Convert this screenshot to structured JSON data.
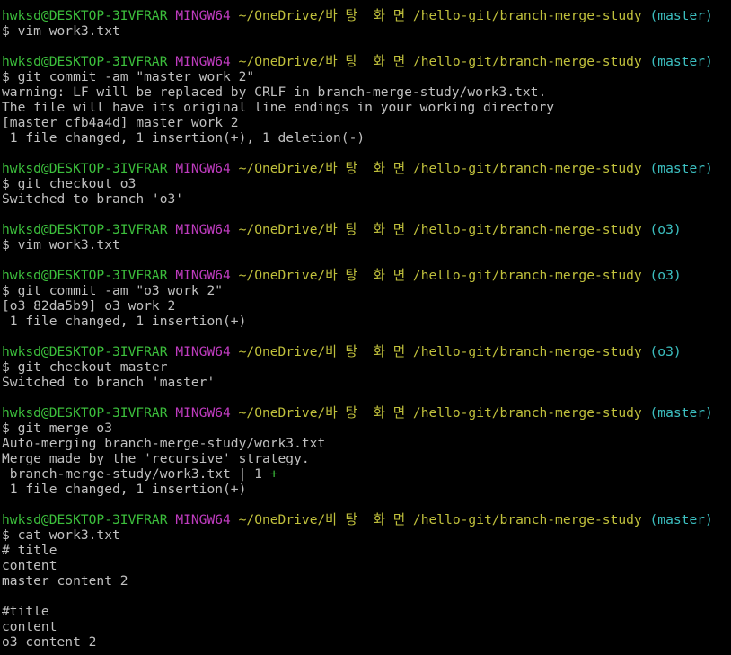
{
  "colors": {
    "background": "#000000",
    "text": "#c0c0c0",
    "user_host": "#3cbf3c",
    "system": "#c03cc0",
    "path": "#c0c03c",
    "branch": "#3cbfc0"
  },
  "prompt": {
    "user_host": "hwksd@DESKTOP-3IVFRAR",
    "system": "MINGW64",
    "path": "~/OneDrive/바 탕  화 면 /hello-git/branch-merge-study"
  },
  "lines": [
    {
      "type": "prompt",
      "branch": "(master)"
    },
    {
      "type": "cmd",
      "text": "$ vim work3.txt"
    },
    {
      "type": "blank",
      "text": ""
    },
    {
      "type": "prompt",
      "branch": "(master)"
    },
    {
      "type": "cmd",
      "text": "$ git commit -am \"master work 2\""
    },
    {
      "type": "out",
      "text": "warning: LF will be replaced by CRLF in branch-merge-study/work3.txt."
    },
    {
      "type": "out",
      "text": "The file will have its original line endings in your working directory"
    },
    {
      "type": "out",
      "text": "[master cfb4a4d] master work 2"
    },
    {
      "type": "out",
      "text": " 1 file changed, 1 insertion(+), 1 deletion(-)"
    },
    {
      "type": "blank",
      "text": ""
    },
    {
      "type": "prompt",
      "branch": "(master)"
    },
    {
      "type": "cmd",
      "text": "$ git checkout o3"
    },
    {
      "type": "out",
      "text": "Switched to branch 'o3'"
    },
    {
      "type": "blank",
      "text": ""
    },
    {
      "type": "prompt",
      "branch": "(o3)"
    },
    {
      "type": "cmd",
      "text": "$ vim work3.txt"
    },
    {
      "type": "blank",
      "text": ""
    },
    {
      "type": "prompt",
      "branch": "(o3)"
    },
    {
      "type": "cmd",
      "text": "$ git commit -am \"o3 work 2\""
    },
    {
      "type": "out",
      "text": "[o3 82da5b9] o3 work 2"
    },
    {
      "type": "out",
      "text": " 1 file changed, 1 insertion(+)"
    },
    {
      "type": "blank",
      "text": ""
    },
    {
      "type": "prompt",
      "branch": "(o3)"
    },
    {
      "type": "cmd",
      "text": "$ git checkout master"
    },
    {
      "type": "out",
      "text": "Switched to branch 'master'"
    },
    {
      "type": "blank",
      "text": ""
    },
    {
      "type": "prompt",
      "branch": "(master)"
    },
    {
      "type": "cmd",
      "text": "$ git merge o3"
    },
    {
      "type": "out",
      "text": "Auto-merging branch-merge-study/work3.txt"
    },
    {
      "type": "out",
      "text": "Merge made by the 'recursive' strategy."
    },
    {
      "type": "stat",
      "text": " branch-merge-study/work3.txt | 1 ",
      "plus": "+"
    },
    {
      "type": "out",
      "text": " 1 file changed, 1 insertion(+)"
    },
    {
      "type": "blank",
      "text": ""
    },
    {
      "type": "prompt",
      "branch": "(master)"
    },
    {
      "type": "cmd",
      "text": "$ cat work3.txt"
    },
    {
      "type": "out",
      "text": "# title"
    },
    {
      "type": "out",
      "text": "content"
    },
    {
      "type": "out",
      "text": "master content 2"
    },
    {
      "type": "blank",
      "text": ""
    },
    {
      "type": "out",
      "text": "#title"
    },
    {
      "type": "out",
      "text": "content"
    },
    {
      "type": "out",
      "text": "o3 content 2"
    }
  ]
}
